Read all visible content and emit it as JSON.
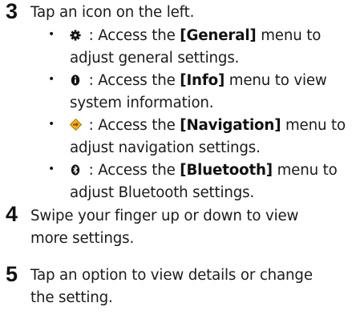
{
  "steps": [
    {
      "number": "3",
      "text": "Tap an icon on the left.",
      "items": [
        {
          "icon": "gear-icon",
          "sep": " : ",
          "pre": "Access the ",
          "keyword": "[General]",
          "post_line1": " menu to",
          "line2": "adjust general settings."
        },
        {
          "icon": "info-icon",
          "sep": " : ",
          "pre": "Access the ",
          "keyword": "[Info]",
          "post_line1": " menu to view",
          "line2": "system information."
        },
        {
          "icon": "navigation-icon",
          "sep": " : ",
          "pre": "Access the ",
          "keyword": "[Navigation]",
          "post_line1": " menu to",
          "line2": "adjust navigation settings."
        },
        {
          "icon": "bluetooth-icon",
          "sep": " : ",
          "pre": "Access the ",
          "keyword": "[Bluetooth]",
          "post_line1": " menu to",
          "line2": "adjust Bluetooth settings."
        }
      ]
    },
    {
      "number": "4",
      "line1": "Swipe your finger up or down to view",
      "line2": "more settings."
    },
    {
      "number": "5",
      "line1": "Tap an option to view details or change",
      "line2": "the setting."
    }
  ],
  "bullet_char": "•",
  "colors": {
    "text": "#1a1a1a",
    "nav_icon_fill": "#f2b705",
    "nav_icon_arrow": "#c0392b"
  }
}
